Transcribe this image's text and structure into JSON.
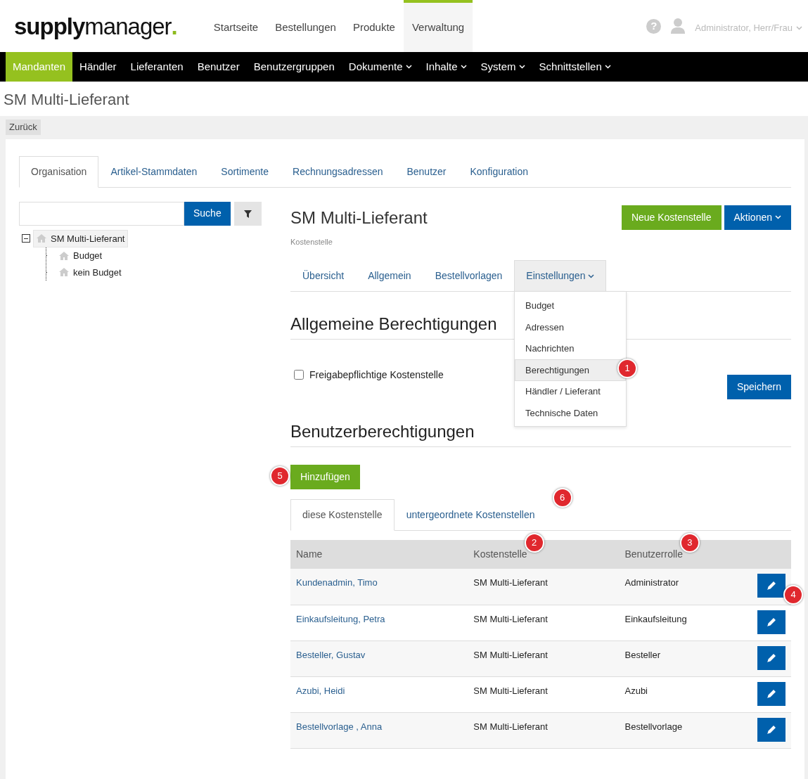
{
  "logo": {
    "bold": "supply",
    "light": "manager",
    "dot": "."
  },
  "top_nav": [
    {
      "label": "Startseite",
      "selected": false
    },
    {
      "label": "Bestellungen",
      "selected": false
    },
    {
      "label": "Produkte",
      "selected": false
    },
    {
      "label": "Verwaltung",
      "selected": true
    }
  ],
  "help": "?",
  "user": {
    "name": "Administrator, Herr/Frau"
  },
  "main_menu": [
    {
      "label": "Mandanten",
      "selected": true,
      "dropdown": false
    },
    {
      "label": "Händler",
      "selected": false,
      "dropdown": false
    },
    {
      "label": "Lieferanten",
      "selected": false,
      "dropdown": false
    },
    {
      "label": "Benutzer",
      "selected": false,
      "dropdown": false
    },
    {
      "label": "Benutzergruppen",
      "selected": false,
      "dropdown": false
    },
    {
      "label": "Dokumente",
      "selected": false,
      "dropdown": true
    },
    {
      "label": "Inhalte",
      "selected": false,
      "dropdown": true
    },
    {
      "label": "System",
      "selected": false,
      "dropdown": true
    },
    {
      "label": "Schnittstellen",
      "selected": false,
      "dropdown": true
    }
  ],
  "page_title": "SM Multi-Lieferant",
  "back_button": "Zurück",
  "tabs": [
    {
      "label": "Organisation",
      "selected": true
    },
    {
      "label": "Artikel-Stammdaten",
      "selected": false
    },
    {
      "label": "Sortimente",
      "selected": false
    },
    {
      "label": "Rechnungsadressen",
      "selected": false
    },
    {
      "label": "Benutzer",
      "selected": false
    },
    {
      "label": "Konfiguration",
      "selected": false
    }
  ],
  "search": {
    "button": "Suche"
  },
  "tree": [
    {
      "label": "SM Multi-Lieferant",
      "selected": true,
      "expanded": true,
      "children": [
        {
          "label": "Budget",
          "selected": false
        },
        {
          "label": "kein Budget",
          "selected": false
        }
      ]
    }
  ],
  "detail": {
    "title": "SM Multi-Lieferant",
    "subtitle": "Kostenstelle",
    "new_button": "Neue Kostenstelle",
    "actions_button": "Aktionen"
  },
  "sub_tabs": [
    {
      "label": "Übersicht",
      "selected": false,
      "dropdown": false
    },
    {
      "label": "Allgemein",
      "selected": false,
      "dropdown": false
    },
    {
      "label": "Bestellvorlagen",
      "selected": false,
      "dropdown": false
    },
    {
      "label": "Einstellungen",
      "selected": true,
      "dropdown": true,
      "expanded": true
    }
  ],
  "settings_menu": [
    {
      "label": "Budget",
      "selected": false
    },
    {
      "label": "Adressen",
      "selected": false
    },
    {
      "label": "Nachrichten",
      "selected": false
    },
    {
      "label": "Berechtigungen",
      "selected": true,
      "marker": "1"
    },
    {
      "label": "Händler / Lieferant",
      "selected": false
    },
    {
      "label": "Technische Daten",
      "selected": false
    }
  ],
  "general_permissions": {
    "heading": "Allgemeine Berechtigungen",
    "checkbox": {
      "label": "Freigabepflichtige Kostenstelle",
      "checked": false
    },
    "save_button": "Speichern"
  },
  "user_permissions": {
    "heading": "Benutzerberechtigungen",
    "add_button": "Hinzufügen",
    "add_marker": "5",
    "tabs": [
      {
        "label": "diese Kostenstelle",
        "selected": true
      },
      {
        "label": "untergeordnete Kostenstellen",
        "selected": false,
        "marker": "6"
      }
    ],
    "columns": [
      {
        "label": "Name"
      },
      {
        "label": "Kostenstelle",
        "marker": "2"
      },
      {
        "label": "Benutzerrolle",
        "marker": "3"
      }
    ],
    "rows": [
      {
        "name": "Kundenadmin, Timo",
        "cost_center": "SM Multi-Lieferant",
        "role": "Administrator",
        "marker": "4"
      },
      {
        "name": "Einkaufsleitung, Petra",
        "cost_center": "SM Multi-Lieferant",
        "role": "Einkaufsleitung"
      },
      {
        "name": "Besteller, Gustav",
        "cost_center": "SM Multi-Lieferant",
        "role": "Besteller"
      },
      {
        "name": "Azubi, Heidi",
        "cost_center": "SM Multi-Lieferant",
        "role": "Azubi"
      },
      {
        "name": "Bestellvorlage , Anna",
        "cost_center": "SM Multi-Lieferant",
        "role": "Bestellvorlage"
      }
    ]
  }
}
